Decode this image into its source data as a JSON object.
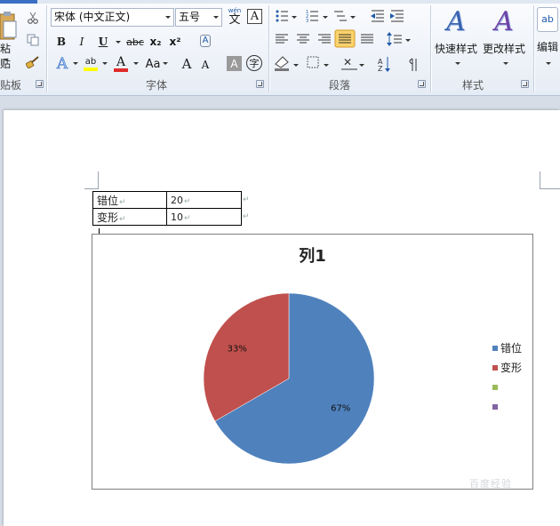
{
  "ribbon": {
    "clipboard": {
      "paste_label": "粘贴",
      "group_label": "贴板"
    },
    "font": {
      "font_name": "宋体 (中文正文)",
      "font_size": "五号",
      "wen_label": "wén",
      "wen_glyph": "文",
      "char_border_glyph": "A",
      "bold": "B",
      "italic": "I",
      "underline": "U",
      "strike": "abc",
      "subscript": "x₂",
      "superscript": "x²",
      "clear": "A",
      "text_effect": "A",
      "highlight": "ab",
      "font_color": "A",
      "change_case": "Aa",
      "grow": "A",
      "shrink": "A",
      "char_shading": "A",
      "enclose": "字",
      "group_label": "字体"
    },
    "paragraph": {
      "group_label": "段落"
    },
    "styles": {
      "quick_label": "快速样式",
      "change_label": "更改样式",
      "group_label": "样式"
    },
    "editing": {
      "label": "编辑"
    }
  },
  "table": {
    "rows": [
      {
        "label": "错位",
        "value": "20"
      },
      {
        "label": "变形",
        "value": "10"
      }
    ]
  },
  "chart_data": {
    "type": "pie",
    "title": "列1",
    "categories": [
      "错位",
      "变形"
    ],
    "values": [
      20,
      10
    ],
    "data_labels": [
      "67%",
      "33%"
    ],
    "colors": [
      "#4f81bd",
      "#c0504d",
      "#9bbb59",
      "#8064a2"
    ],
    "legend": [
      "错位",
      "变形",
      "",
      ""
    ],
    "legend_position": "right"
  },
  "colors": {
    "accent": "#3a6fc4",
    "highlight_active": "#fbd36b"
  },
  "watermark": "百度经验"
}
